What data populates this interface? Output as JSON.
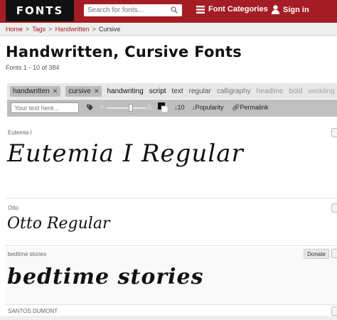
{
  "header": {
    "logo": "FONTS",
    "search_placeholder": "Search for fonts...",
    "nav_categories": "Font Categories",
    "nav_signin": "Sign in",
    "brand_color": "#a51d24"
  },
  "breadcrumb": [
    "Home",
    "Tags",
    "Handwritten",
    "Cursive"
  ],
  "page": {
    "title": "Handwritten, Cursive Fonts",
    "subtitle": "Fonts 1 - 10 of 384"
  },
  "tags": {
    "selected": [
      "handwritten",
      "cursive"
    ],
    "suggested": [
      "handwriting",
      "script",
      "text",
      "regular",
      "calligraphy",
      "headline",
      "bold",
      "wedding"
    ]
  },
  "toolbar": {
    "text_placeholder": "Your text here...",
    "size_value": "10",
    "sort_label": "Popularity",
    "permalink_label": "Permalink"
  },
  "fonts": [
    {
      "name": "Eutemia I",
      "preview": "Eutemia I Regular"
    },
    {
      "name": "Otto",
      "preview": "Otto Regular"
    },
    {
      "name": "bedtime stories",
      "preview": "bedtime stories",
      "donate": "Donate"
    },
    {
      "name": "SANTOS DUMONT",
      "preview": ""
    }
  ]
}
